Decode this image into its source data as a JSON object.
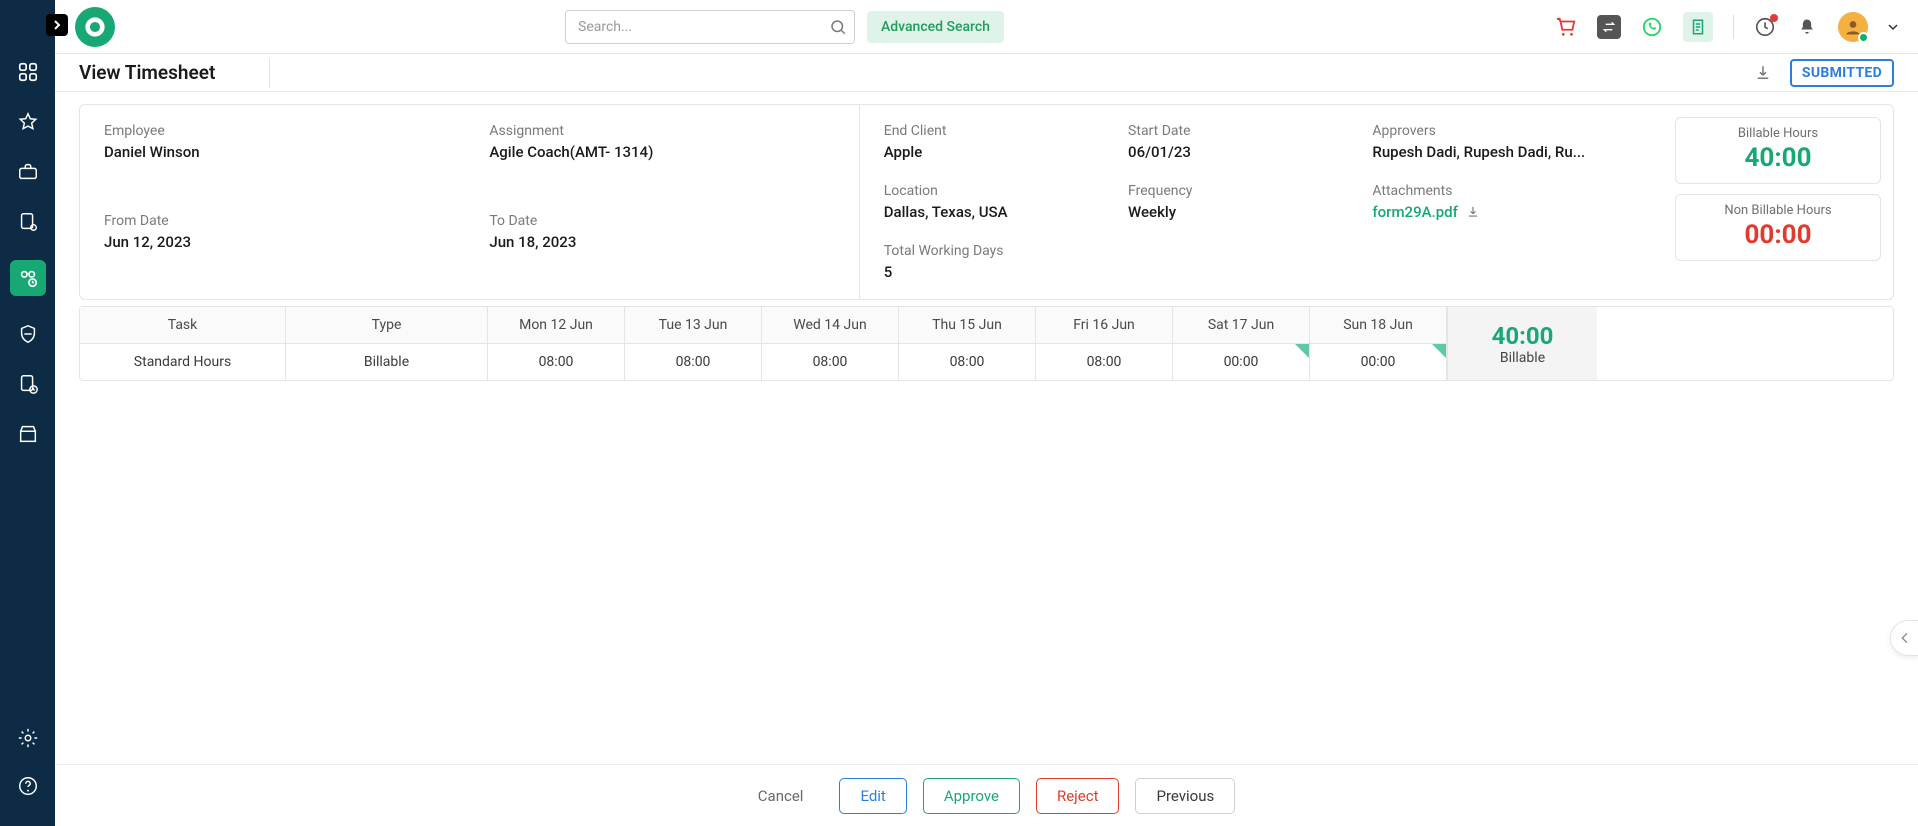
{
  "header": {
    "search_placeholder": "Search...",
    "advanced_search": "Advanced Search"
  },
  "page": {
    "title": "View Timesheet",
    "status": "SUBMITTED"
  },
  "details": {
    "employee_label": "Employee",
    "employee_value": "Daniel Winson",
    "assignment_label": "Assignment",
    "assignment_value": "Agile Coach(AMT- 1314)",
    "from_label": "From Date",
    "from_value": "Jun 12, 2023",
    "to_label": "To Date",
    "to_value": "Jun 18, 2023",
    "end_client_label": "End Client",
    "end_client_value": "Apple",
    "start_date_label": "Start Date",
    "start_date_value": "06/01/23",
    "approvers_label": "Approvers",
    "approvers_value": "Rupesh Dadi, Rupesh Dadi, Ru...",
    "location_label": "Location",
    "location_value": "Dallas, Texas, USA",
    "frequency_label": "Frequency",
    "frequency_value": "Weekly",
    "attachments_label": "Attachments",
    "attachments_value": "form29A.pdf",
    "working_days_label": "Total Working Days",
    "working_days_value": "5"
  },
  "hours": {
    "billable_label": "Billable Hours",
    "billable_value": "40:00",
    "non_billable_label": "Non Billable Hours",
    "non_billable_value": "00:00"
  },
  "table": {
    "headers": {
      "task": "Task",
      "type": "Type",
      "days": [
        "Mon 12 Jun",
        "Tue 13 Jun",
        "Wed 14 Jun",
        "Thu 15 Jun",
        "Fri 16 Jun",
        "Sat 17 Jun",
        "Sun 18 Jun"
      ]
    },
    "row": {
      "task": "Standard Hours",
      "type": "Billable",
      "values": [
        "08:00",
        "08:00",
        "08:00",
        "08:00",
        "08:00",
        "00:00",
        "00:00"
      ]
    },
    "total_hours": "40:00",
    "total_label": "Billable"
  },
  "actions": {
    "cancel": "Cancel",
    "edit": "Edit",
    "approve": "Approve",
    "reject": "Reject",
    "previous": "Previous"
  }
}
